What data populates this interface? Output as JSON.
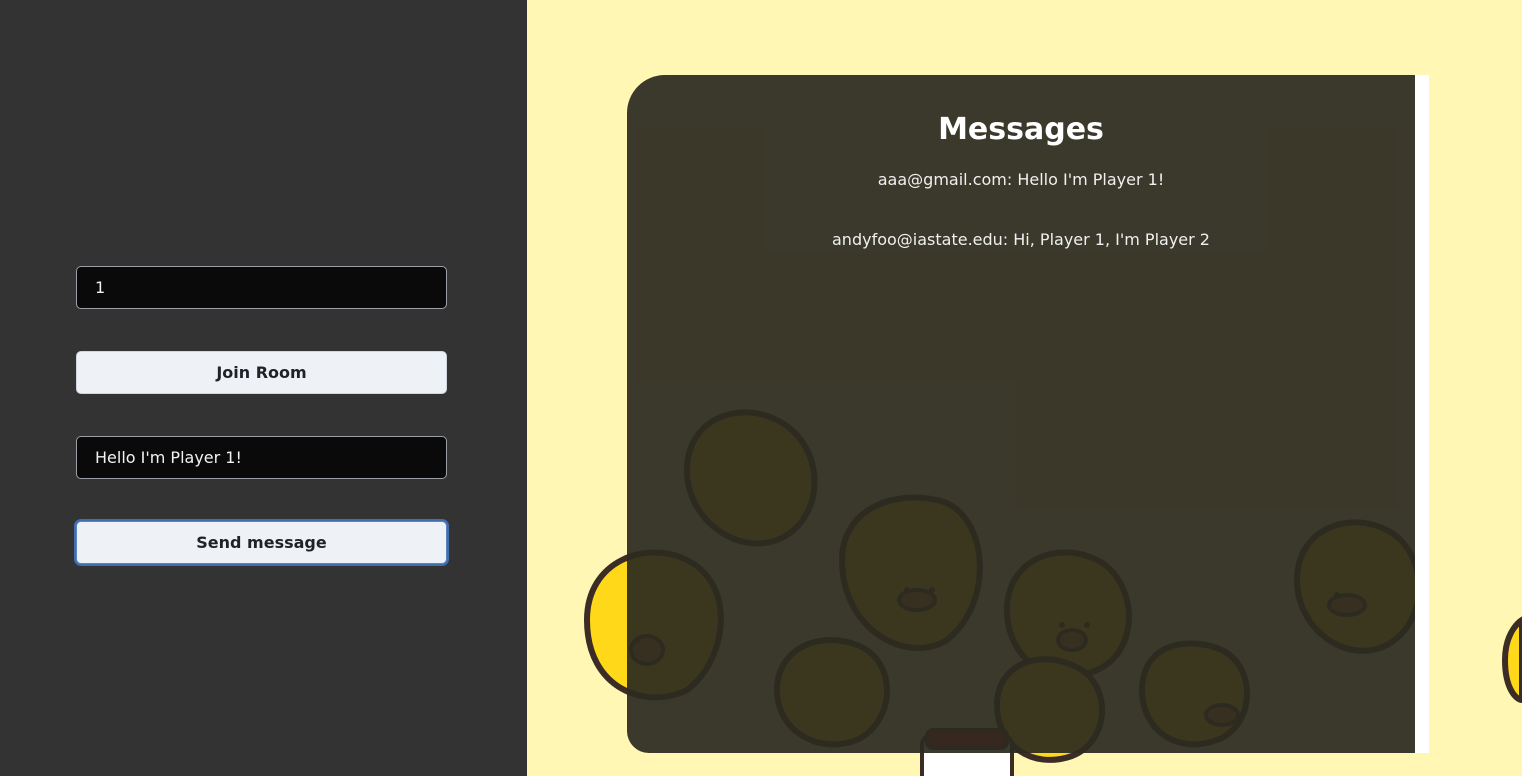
{
  "left_panel": {
    "room_input": {
      "value": "1"
    },
    "join_button": {
      "label": "Join Room"
    },
    "message_input": {
      "value": "Hello I'm Player 1!"
    },
    "send_button": {
      "label": "Send message"
    }
  },
  "messages_panel": {
    "title": "Messages",
    "messages": [
      {
        "text": "aaa@gmail.com: Hello I'm Player 1!"
      },
      {
        "text": "andyfoo@iastate.edu: Hi, Player 1, I'm Player 2"
      }
    ]
  },
  "colors": {
    "left_bg": "#333333",
    "right_bg": "#fff7b3",
    "chick_yellow": "#ffd81a",
    "outline": "#3b2d25"
  }
}
